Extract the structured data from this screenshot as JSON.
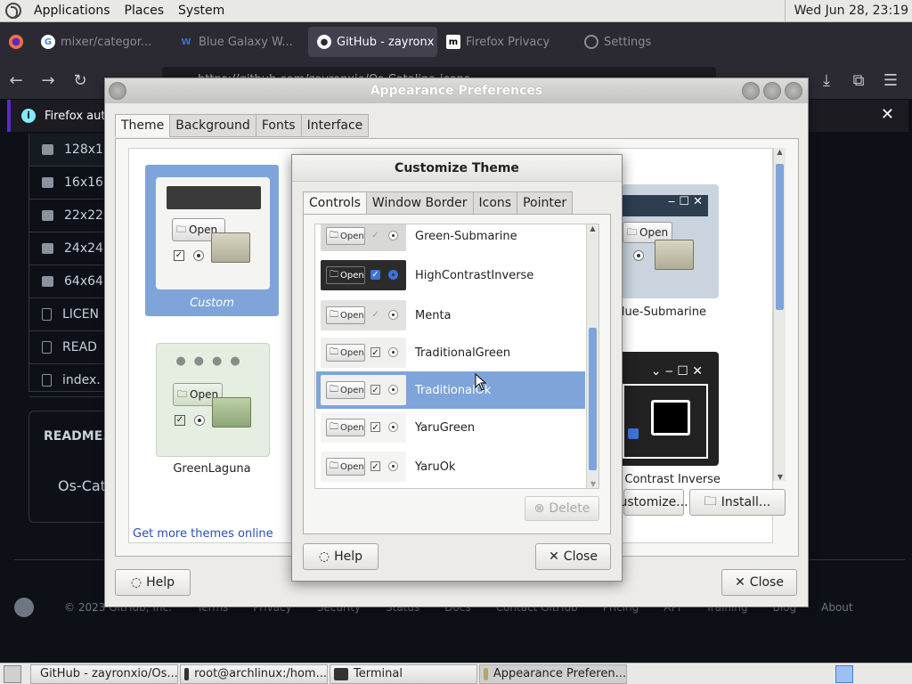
{
  "top_panel": {
    "menus": [
      "Applications",
      "Places",
      "System"
    ],
    "clock": "Wed Jun 28, 23:19"
  },
  "firefox": {
    "tabs": [
      {
        "title": "mixer/categor...",
        "active": false
      },
      {
        "title": "Blue Galaxy W...",
        "active": false
      },
      {
        "title": "GitHub - zayronx",
        "active": true
      },
      {
        "title": "Firefox Privacy",
        "active": false
      },
      {
        "title": "Settings",
        "active": false
      }
    ],
    "url": "https://github.com/zayronxio/Os-Catalina-icons",
    "notice": "Firefox autom"
  },
  "github": {
    "files": [
      "128x1",
      "16x16",
      "22x22",
      "24x24",
      "64x64",
      "LICEN",
      "READ",
      "index."
    ],
    "readme_title": "README.m",
    "readme_text": "Os-Cat",
    "footer": [
      "© 2023 GitHub, Inc.",
      "Terms",
      "Privacy",
      "Security",
      "Status",
      "Docs",
      "Contact GitHub",
      "Pricing",
      "API",
      "Training",
      "Blog",
      "About"
    ]
  },
  "appearance": {
    "title": "Appearance Preferences",
    "tabs": [
      "Theme",
      "Background",
      "Fonts",
      "Interface"
    ],
    "themes": {
      "custom": "Custom",
      "blue_submarine": "Blue-Submarine",
      "green_laguna": "GreenLaguna",
      "high_contrast": "n Contrast Inverse"
    },
    "preview_open": "Open",
    "more_themes_link": "Get more themes online",
    "customize_button": "ustomize...",
    "install_button": "Install...",
    "help_button": "Help",
    "close_button": "Close"
  },
  "customize": {
    "title": "Customize Theme",
    "tabs": [
      "Controls",
      "Window Border",
      "Icons",
      "Pointer"
    ],
    "items": [
      {
        "name": "Green-Submarine",
        "selected": false
      },
      {
        "name": "HighContrastInverse",
        "selected": false
      },
      {
        "name": "Menta",
        "selected": false
      },
      {
        "name": "TraditionalGreen",
        "selected": false
      },
      {
        "name": "TraditionalOk",
        "selected": true
      },
      {
        "name": "YaruGreen",
        "selected": false
      },
      {
        "name": "YaruOk",
        "selected": false
      }
    ],
    "open_label": "Open",
    "delete_button": "Delete",
    "help_button": "Help",
    "close_button": "Close"
  },
  "taskbar": {
    "tasks": [
      {
        "label": "GitHub - zayronxio/Os...",
        "active": false
      },
      {
        "label": "root@archlinux:/hom...",
        "active": false
      },
      {
        "label": "Terminal",
        "active": false
      },
      {
        "label": "Appearance Preferen...",
        "active": true
      }
    ]
  },
  "colors": {
    "selection": "#7ea4da",
    "ff_dark": "#2b2a33",
    "gh_bg": "#0d1117"
  }
}
